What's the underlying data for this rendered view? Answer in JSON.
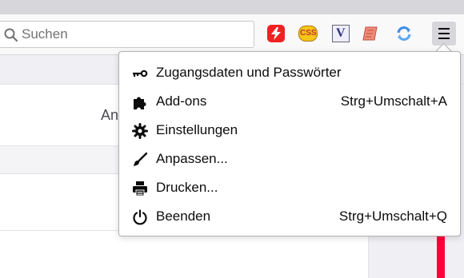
{
  "toolbar": {
    "search": {
      "placeholder": "Suchen",
      "icon": "search-icon"
    },
    "extensions": [
      {
        "name": "red-lightning-extension",
        "icon": "lightning-icon",
        "color": "#e22222"
      },
      {
        "name": "css-extension",
        "label": "CSS",
        "icon": "css-smiley-icon",
        "color": "#f5c518"
      },
      {
        "name": "v-extension",
        "label": "V",
        "icon": "v-letter-icon"
      },
      {
        "name": "scroll-extension",
        "icon": "scroll-icon",
        "color": "#e8796a"
      },
      {
        "name": "sync-extension",
        "icon": "sync-icon",
        "color": "#3d8ee6"
      }
    ],
    "menu_button_icon": "hamburger-icon"
  },
  "page": {
    "heading_peek": "An"
  },
  "menu": {
    "items": [
      {
        "label": "Zugangsdaten und Passwörter",
        "shortcut": "",
        "icon": "key-icon"
      },
      {
        "label": "Add-ons",
        "shortcut": "Strg+Umschalt+A",
        "icon": "puzzle-icon"
      },
      {
        "label": "Einstellungen",
        "shortcut": "",
        "icon": "gear-icon"
      },
      {
        "label": "Anpassen...",
        "shortcut": "",
        "icon": "paintbrush-icon"
      },
      {
        "label": "Drucken...",
        "shortcut": "",
        "icon": "printer-icon"
      },
      {
        "label": "Beenden",
        "shortcut": "Strg+Umschalt+Q",
        "icon": "power-icon"
      }
    ]
  },
  "colors": {
    "accent_red": "#ff0039",
    "toolbar_bg": "#f9f9fa",
    "menu_button_bg": "#d7d7db"
  }
}
